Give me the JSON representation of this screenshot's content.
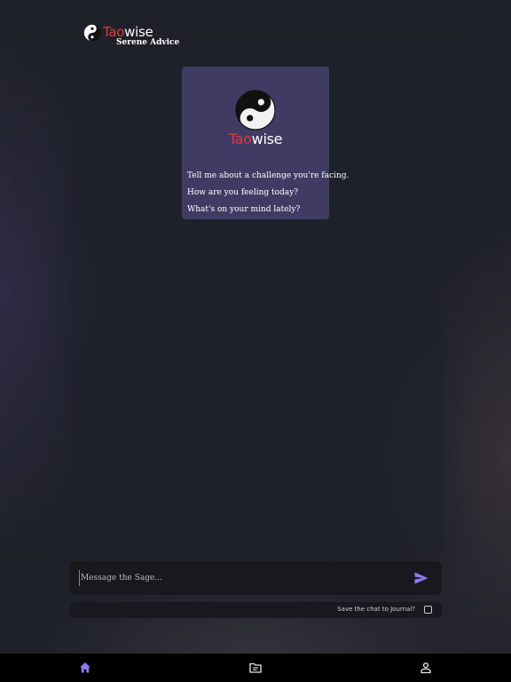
{
  "header": {
    "brand_part1": "Tao",
    "brand_part2": "wise",
    "tagline": "Serene Advice"
  },
  "card": {
    "brand_part1": "Tao",
    "brand_part2": "wise",
    "prompts": [
      "Tell me about a challenge you're facing.",
      "How are you feeling today?",
      "What's on your mind lately?"
    ]
  },
  "composer": {
    "placeholder": "Message the Sage...",
    "value": ""
  },
  "save": {
    "label": "Save the chat to Journal?",
    "checked": false
  },
  "nav": {
    "items": [
      {
        "icon": "home-icon",
        "active": true
      },
      {
        "icon": "journal-folder-icon",
        "active": false
      },
      {
        "icon": "profile-icon",
        "active": false
      }
    ]
  },
  "colors": {
    "accent": "#8b7cf0",
    "brand_red": "#e0373f",
    "card_bg": "#413b64"
  }
}
